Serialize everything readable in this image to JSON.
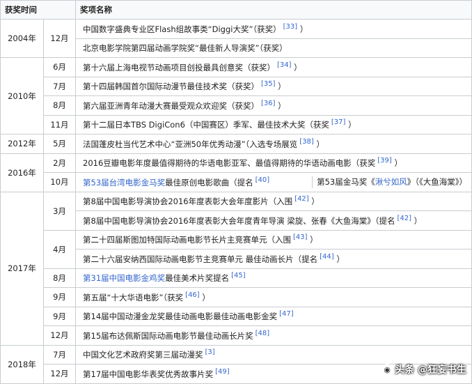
{
  "header": {
    "col1": "获奖时间",
    "col2": "奖项名称"
  },
  "rows": [
    {
      "year": "2004年",
      "month": "12月",
      "award": "中国数字盛典专业区Flash组故事类“Diggi大奖”（获奖）",
      "ref": "[33]"
    },
    {
      "year": "",
      "month": "",
      "award": "北京电影学院第四届动画学院奖“最佳新人导演奖”（获奖）",
      "ref": ""
    },
    {
      "year": "2010年",
      "month": "6月",
      "award": "第十六届上海电视节动画项目创投最具创意奖（获奖）",
      "ref": "[34]"
    },
    {
      "year": "",
      "month": "7月",
      "award": "第十四届韩国首尔国际动漫节最佳技术奖（获奖）",
      "ref": "[35]"
    },
    {
      "year": "",
      "month": "8月",
      "award": "第六届亚洲青年动漫大赛最受观众欢迎奖（获奖）",
      "ref": "[36]"
    },
    {
      "year": "",
      "month": "11月",
      "award": "第十二届日本TBS DigiCon6（中国赛区）季军、最佳技术大奖（获奖",
      "ref": "[37]"
    },
    {
      "year": "2012年",
      "month": "5月",
      "award": "法国蓬皮杜当代艺术中心“亚洲50年优秀动漫”（入选专场展览",
      "ref": "[38]"
    },
    {
      "year": "2016年",
      "month": "2月",
      "award": "2016豆瓣电影年度最值得期待的华语电影亚军、最值得期待的华语动画电影（获奖",
      "ref": "[39]"
    },
    {
      "year": "",
      "month": "10月",
      "award_link": "第53届台湾电影金马奖",
      "award_after": "最佳原创电影歌曲（提名",
      "ref": "[40]",
      "award2_pre": "第53届金马奖《",
      "award2_link": "湫兮如风",
      "award2_post": "》（《大鱼海棠》）"
    },
    {
      "year": "2017年",
      "month": "3月",
      "award": "第8届中国电影导演协会2016年度表彰大会年度影片（入围",
      "ref": "[42]"
    },
    {
      "year": "",
      "month": "",
      "award": "第8届中国电影导演协会2016年度表彰大会年度青年导演 梁旋、张春《大鱼海棠》（提名",
      "ref": "[42]"
    },
    {
      "year": "",
      "month": "4月",
      "award": "第二十四届斯图加特国际动画电影节长片主竞赛单元（入围",
      "ref": "[43]"
    },
    {
      "year": "",
      "month": "",
      "award": "第二十六届安纳西国际动画电影节主竞赛单元 最佳动画长片（提名",
      "ref": "[44]"
    },
    {
      "year": "",
      "month": "8月",
      "award_link": "第31届中国电影金鸡奖",
      "award_after": "最佳美术片奖提名",
      "ref": "[45]"
    },
    {
      "year": "",
      "month": "9月",
      "award": "第五届“十大华语电影”（获奖",
      "ref": "[46]"
    },
    {
      "year": "",
      "month": "9月",
      "award": "第14届中国动漫金龙奖最佳动画电影最佳动画电影金奖",
      "ref": "[47]"
    },
    {
      "year": "",
      "month": "12月",
      "award": "第15届布达佩斯国际动画电影节最佳动画长片奖",
      "ref": "[48]"
    },
    {
      "year": "2018年",
      "month": "7月",
      "award": "中国文化艺术政府奖第三届动漫奖",
      "ref": "[3]"
    },
    {
      "year": "",
      "month": "12月",
      "award": "第17届中国电影华表奖优秀故事片奖",
      "ref": "[49]"
    }
  ],
  "watermark": "头条 @狂妄书生",
  "colors": {
    "link": "#3366cc",
    "border": "#c8ccd1",
    "header_bg": "#f8f9fa"
  }
}
